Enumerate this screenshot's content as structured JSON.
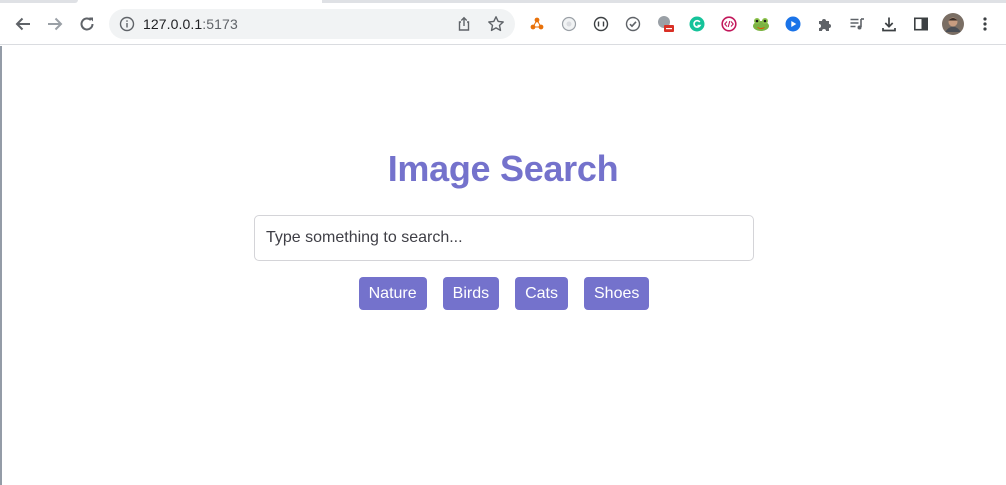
{
  "browser": {
    "url_host": "127.0.0.1",
    "url_port": ":5173",
    "nav": {
      "back_icon": "arrow-left-icon",
      "forward_icon": "arrow-right-icon",
      "reload_icon": "reload-icon"
    },
    "extensions": [
      "extension-a-icon",
      "extension-b-icon",
      "extension-c-icon",
      "extension-d-icon",
      "extension-e-icon",
      "grammarly-icon",
      "extension-f-icon",
      "frog-extension-icon",
      "extension-g-icon",
      "puzzle-icon",
      "media-queue-icon",
      "download-icon",
      "sidepanel-icon",
      "avatar",
      "kebab-menu-icon"
    ],
    "accent": "#7472cc"
  },
  "main": {
    "title": "Image Search",
    "search": {
      "placeholder": "Type something to search...",
      "value": ""
    },
    "chips": [
      "Nature",
      "Birds",
      "Cats",
      "Shoes"
    ]
  }
}
